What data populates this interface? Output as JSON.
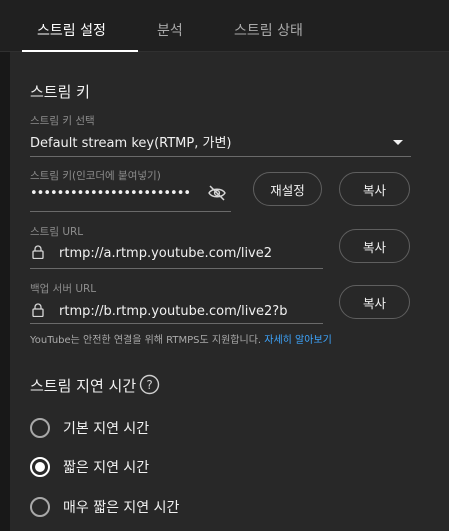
{
  "tabs": [
    {
      "label": "스트림 설정",
      "active": true
    },
    {
      "label": "분석",
      "active": false
    },
    {
      "label": "스트림 상태",
      "active": false
    }
  ],
  "stream_key": {
    "title": "스트림 키",
    "select_label": "스트림 키 선택",
    "select_value": "Default stream key(RTMP, 가변)",
    "key_label": "스트림 키(인코더에 붙여넣기)",
    "key_value": "••••••••••••••••••••••••",
    "reset_button": "재설정",
    "copy_button": "복사",
    "url_label": "스트림 URL",
    "url_value": "rtmp://a.rtmp.youtube.com/live2",
    "backup_label": "백업 서버 URL",
    "backup_value": "rtmp://b.rtmp.youtube.com/live2?b",
    "note_text": "YouTube는 안전한 연결을 위해 RTMPS도 지원합니다.",
    "note_link": "자세히 알아보기"
  },
  "latency": {
    "title": "스트림 지연 시간",
    "options": [
      {
        "label": "기본 지연 시간",
        "selected": false
      },
      {
        "label": "짧은 지연 시간",
        "selected": true
      },
      {
        "label": "매우 짧은 지연 시간",
        "selected": false
      }
    ]
  },
  "icons": {
    "dropdown": "caret-down-icon",
    "visibility": "eye-off-icon",
    "lock": "lock-icon",
    "help": "help-icon"
  }
}
